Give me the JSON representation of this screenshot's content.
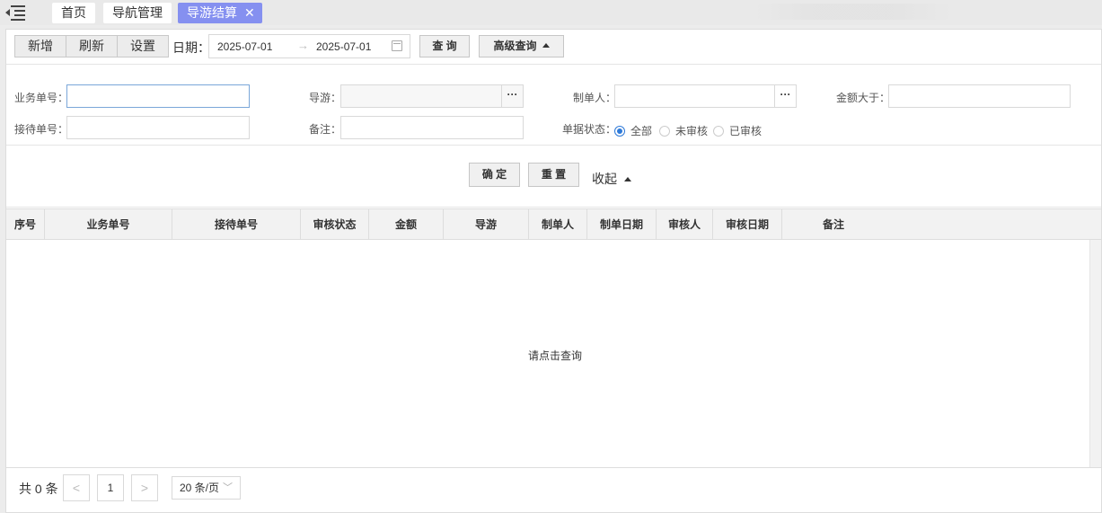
{
  "tabs": [
    {
      "label": "首页"
    },
    {
      "label": "导航管理"
    },
    {
      "label": "导游结算",
      "close": "✕"
    }
  ],
  "toolbar": {
    "add_label": "新增",
    "refresh_label": "刷新",
    "settings_label": "设置",
    "date_label": "日期：",
    "date_start": "2025-07-01",
    "date_arrow": "→",
    "date_end": "2025-07-01",
    "query_label": "查 询",
    "advanced_label": "高级查询"
  },
  "filters": {
    "business_no_label": "业务单号：",
    "guide_label": "导游：",
    "creator_label": "制单人：",
    "amount_gt_label": "金额大于：",
    "reception_no_label": "接待单号：",
    "remark_label": "备注：",
    "status_label": "单据状态：",
    "status_options": [
      "全部",
      "未审核",
      "已审核"
    ],
    "status_selected": "全部",
    "dots": "···"
  },
  "confirm": {
    "ok_label": "确 定",
    "reset_label": "重 置",
    "collapse_label": "收起"
  },
  "table": {
    "columns": [
      "序号",
      "业务单号",
      "接待单号",
      "审核状态",
      "金额",
      "导游",
      "制单人",
      "制单日期",
      "审核人",
      "审核日期",
      "备注"
    ],
    "empty_message": "请点击查询"
  },
  "pager": {
    "total_label": "共 0 条",
    "prev": "<",
    "current_page": "1",
    "next": ">",
    "page_size": "20 条/页"
  },
  "colors": {
    "active_tab": "#8590f0",
    "radio_selected": "#2f7ad8"
  }
}
